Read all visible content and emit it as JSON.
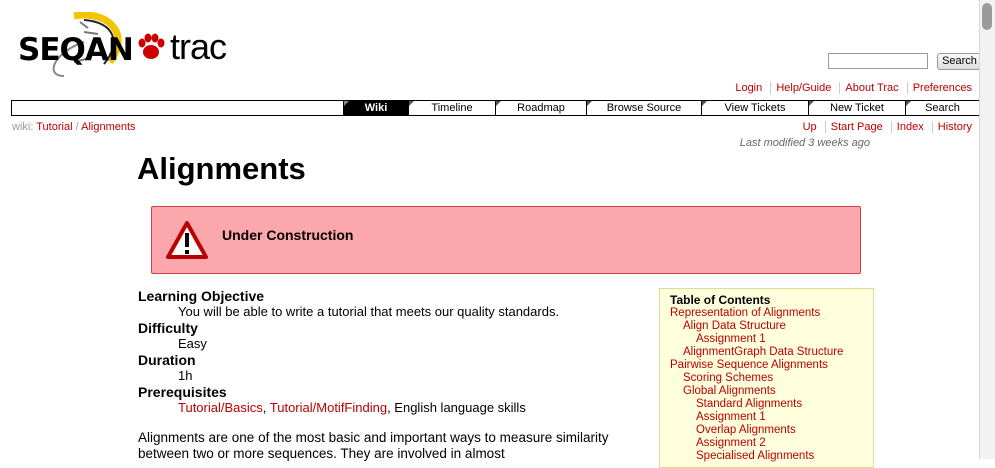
{
  "logo": {
    "brand": "SEQAN",
    "product": "trac"
  },
  "search": {
    "button_label": "Search",
    "placeholder": ""
  },
  "metanav": [
    "Login",
    "Help/Guide",
    "About Trac",
    "Preferences"
  ],
  "mainnav": [
    {
      "label": "Wiki",
      "active": true
    },
    {
      "label": "Timeline",
      "active": false
    },
    {
      "label": "Roadmap",
      "active": false
    },
    {
      "label": "Browse Source",
      "active": false
    },
    {
      "label": "View Tickets",
      "active": false
    },
    {
      "label": "New Ticket",
      "active": false
    },
    {
      "label": "Search",
      "active": false
    }
  ],
  "breadcrumb": {
    "prefix": "wiki:",
    "parts": [
      "Tutorial",
      "Alignments"
    ],
    "separator": "/"
  },
  "ctxtnav": [
    "Up",
    "Start Page",
    "Index",
    "History"
  ],
  "last_modified": "Last modified 3 weeks ago",
  "page_title": "Alignments",
  "warning": {
    "title": "Under Construction"
  },
  "definitions": {
    "learning_objective": {
      "term": "Learning Objective",
      "desc": "You will be able to write a tutorial that meets our quality standards."
    },
    "difficulty": {
      "term": "Difficulty",
      "desc": "Easy"
    },
    "duration": {
      "term": "Duration",
      "desc": "1h"
    },
    "prerequisites": {
      "term": "Prerequisites",
      "link1": "Tutorial/Basics",
      "link2": "Tutorial/MotifFinding",
      "rest": ", English language skills"
    }
  },
  "intro_paragraph": "Alignments are one of the most basic and important ways to measure similarity between two or more sequences. They are involved in almost",
  "toc": {
    "title": "Table of Contents",
    "items": [
      {
        "label": "Representation of Alignments",
        "level": 1
      },
      {
        "label": "Align Data Structure",
        "level": 2
      },
      {
        "label": "Assignment 1",
        "level": 3
      },
      {
        "label": "AlignmentGraph Data Structure",
        "level": 2
      },
      {
        "label": "Pairwise Sequence Alignments",
        "level": 1
      },
      {
        "label": "Scoring Schemes",
        "level": 2
      },
      {
        "label": "Global Alignments",
        "level": 2
      },
      {
        "label": "Standard Alignments",
        "level": 3
      },
      {
        "label": "Assignment 1",
        "level": 3
      },
      {
        "label": "Overlap Alignments",
        "level": 3
      },
      {
        "label": "Assignment 2",
        "level": 3
      },
      {
        "label": "Specialised Alignments",
        "level": 3
      }
    ]
  },
  "colors": {
    "link": "#bb0000",
    "warning_bg": "#fca7ab",
    "toc_bg": "#ffffdd",
    "nav_active": "#000000"
  }
}
